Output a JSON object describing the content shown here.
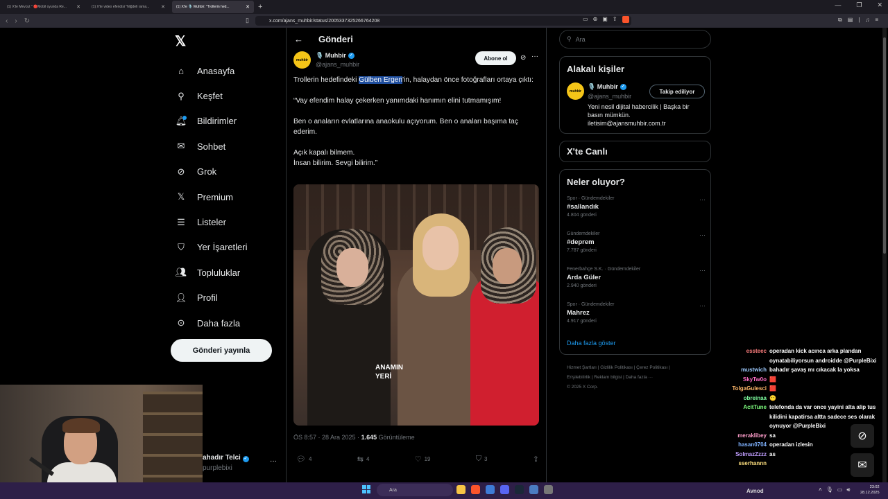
{
  "browser": {
    "tabs": [
      {
        "title": "(1) X'te Mevcut \" 🔴Mobil oyunda Re..."
      },
      {
        "title": "(1) X'te video efendisi \"Niğdeli rama..."
      },
      {
        "title": "(1) X'te 🎙️ Muhbir: \"Trollerin hed..."
      }
    ],
    "url": "x.com/ajans_muhbir/status/2005337325266764208"
  },
  "nav": {
    "items": [
      "Anasayfa",
      "Keşfet",
      "Bildirimler",
      "Sohbet",
      "Grok",
      "Premium",
      "Listeler",
      "Yer İşaretleri",
      "Topluluklar",
      "Profil",
      "Daha fazla"
    ],
    "post_button": "Gönderi yayınla",
    "account_name": "ahadır Telci",
    "account_handle": "purplebixi"
  },
  "post": {
    "header": "Gönderi",
    "author_name": "🎙️ Muhbir",
    "author_handle": "@ajans_muhbir",
    "avatar_text": "muhbir",
    "follow_label": "Abone ol",
    "text_before": "Trollerin hedefindeki ",
    "text_highlight": "Gülben Ergen",
    "text_after": "'in, halaydan önce fotoğrafları ortaya çıktı:",
    "quote1": "“Vay efendim halay çekerken yanımdaki hanımın elini tutmamışım!",
    "quote2": "Ben o anaların evlatlarına anaokulu açıyorum. Ben o anaları başıma taç ederim.",
    "quote3a": "Açık kapalı bilmem.",
    "quote3b": "İnsan bilirim. Sevgi bilirim.”",
    "photo_apron": "ANAMIN\nYERİ",
    "time": "ÖS 8:57 · 28 Ara 2025 · ",
    "views": "1.645",
    "views_label": " Görüntüleme",
    "replies": "4",
    "reposts": "4",
    "likes": "19",
    "bookmarks": "3"
  },
  "sidebar": {
    "search_placeholder": "Ara",
    "related_title": "Alakalı kişiler",
    "related_name": "🎙️ Muhbir",
    "related_handle": "@ajans_muhbir",
    "related_bio": "Yeni nesil dijital habercilik | Başka bir basın mümkün. iletisim@ajansmuhbir.com.tr",
    "related_follow": "Takip ediliyor",
    "live_title": "X'te Canlı",
    "trending_title": "Neler oluyor?",
    "trends": [
      {
        "category": "Spor · Gündemdekiler",
        "title": "#sallandık",
        "count": "4.804 gönderi"
      },
      {
        "category": "Gündemdekiler",
        "title": "#deprem",
        "count": "7.787 gönderi"
      },
      {
        "category": "Fenerbahçe S.K. · Gündemdekiler",
        "title": "Arda Güler",
        "count": "2.940 gönderi"
      },
      {
        "category": "Spor · Gündemdekiler",
        "title": "Mahrez",
        "count": "4.917 gönderi"
      }
    ],
    "show_more": "Daha fazla göster",
    "footer_line1": "Hizmet Şartları  |  Gizlilik Politikası  |  Çerez Politikası  |",
    "footer_line2": "Erişilebilirlik  |  Reklam bilgisi  |  Daha fazla ···",
    "footer_line3": "© 2025 X Corp."
  },
  "chat": [
    {
      "user": "essteec",
      "color": "#ff7f7f",
      "text": "operadan kick acınca arka plandan oynatabiliyorsun androidde @PurpleBixi"
    },
    {
      "user": "mustwich",
      "color": "#9ecbff",
      "text": "bahadır şavaş mı cıkacak la yoksa"
    },
    {
      "user": "SkyTw0o",
      "color": "#ff6ec7",
      "text": "🟥"
    },
    {
      "user": "TolgaGulesci",
      "color": "#ffb86b",
      "text": "🟥"
    },
    {
      "user": "obreinaa",
      "color": "#7fffa0",
      "text": "😶"
    },
    {
      "user": "AcitTune",
      "color": "#7fff7f",
      "text": "telefonda da var once yayini alta alip tus kilidini kapatirsa altta sadece ses olarak oynuyor @PurpleBixi"
    },
    {
      "user": "meraklibey",
      "color": "#ff9ecb",
      "text": "sa"
    },
    {
      "user": "hasan0704",
      "color": "#7fb2ff",
      "text": "operadan izlesin"
    },
    {
      "user": "SolmazZzzz",
      "color": "#c09eff",
      "text": "as"
    },
    {
      "user": "sserhannn",
      "color": "#ffe07f",
      "text": ""
    }
  ],
  "taskbar": {
    "search": "Ara",
    "user_label": "Avnod",
    "time": "23:02",
    "date": "28.12.2025"
  },
  "colors": {
    "accent": "#1d9bf0",
    "brand_avatar": "#f5c518",
    "taskbar": "#2e1f48"
  }
}
